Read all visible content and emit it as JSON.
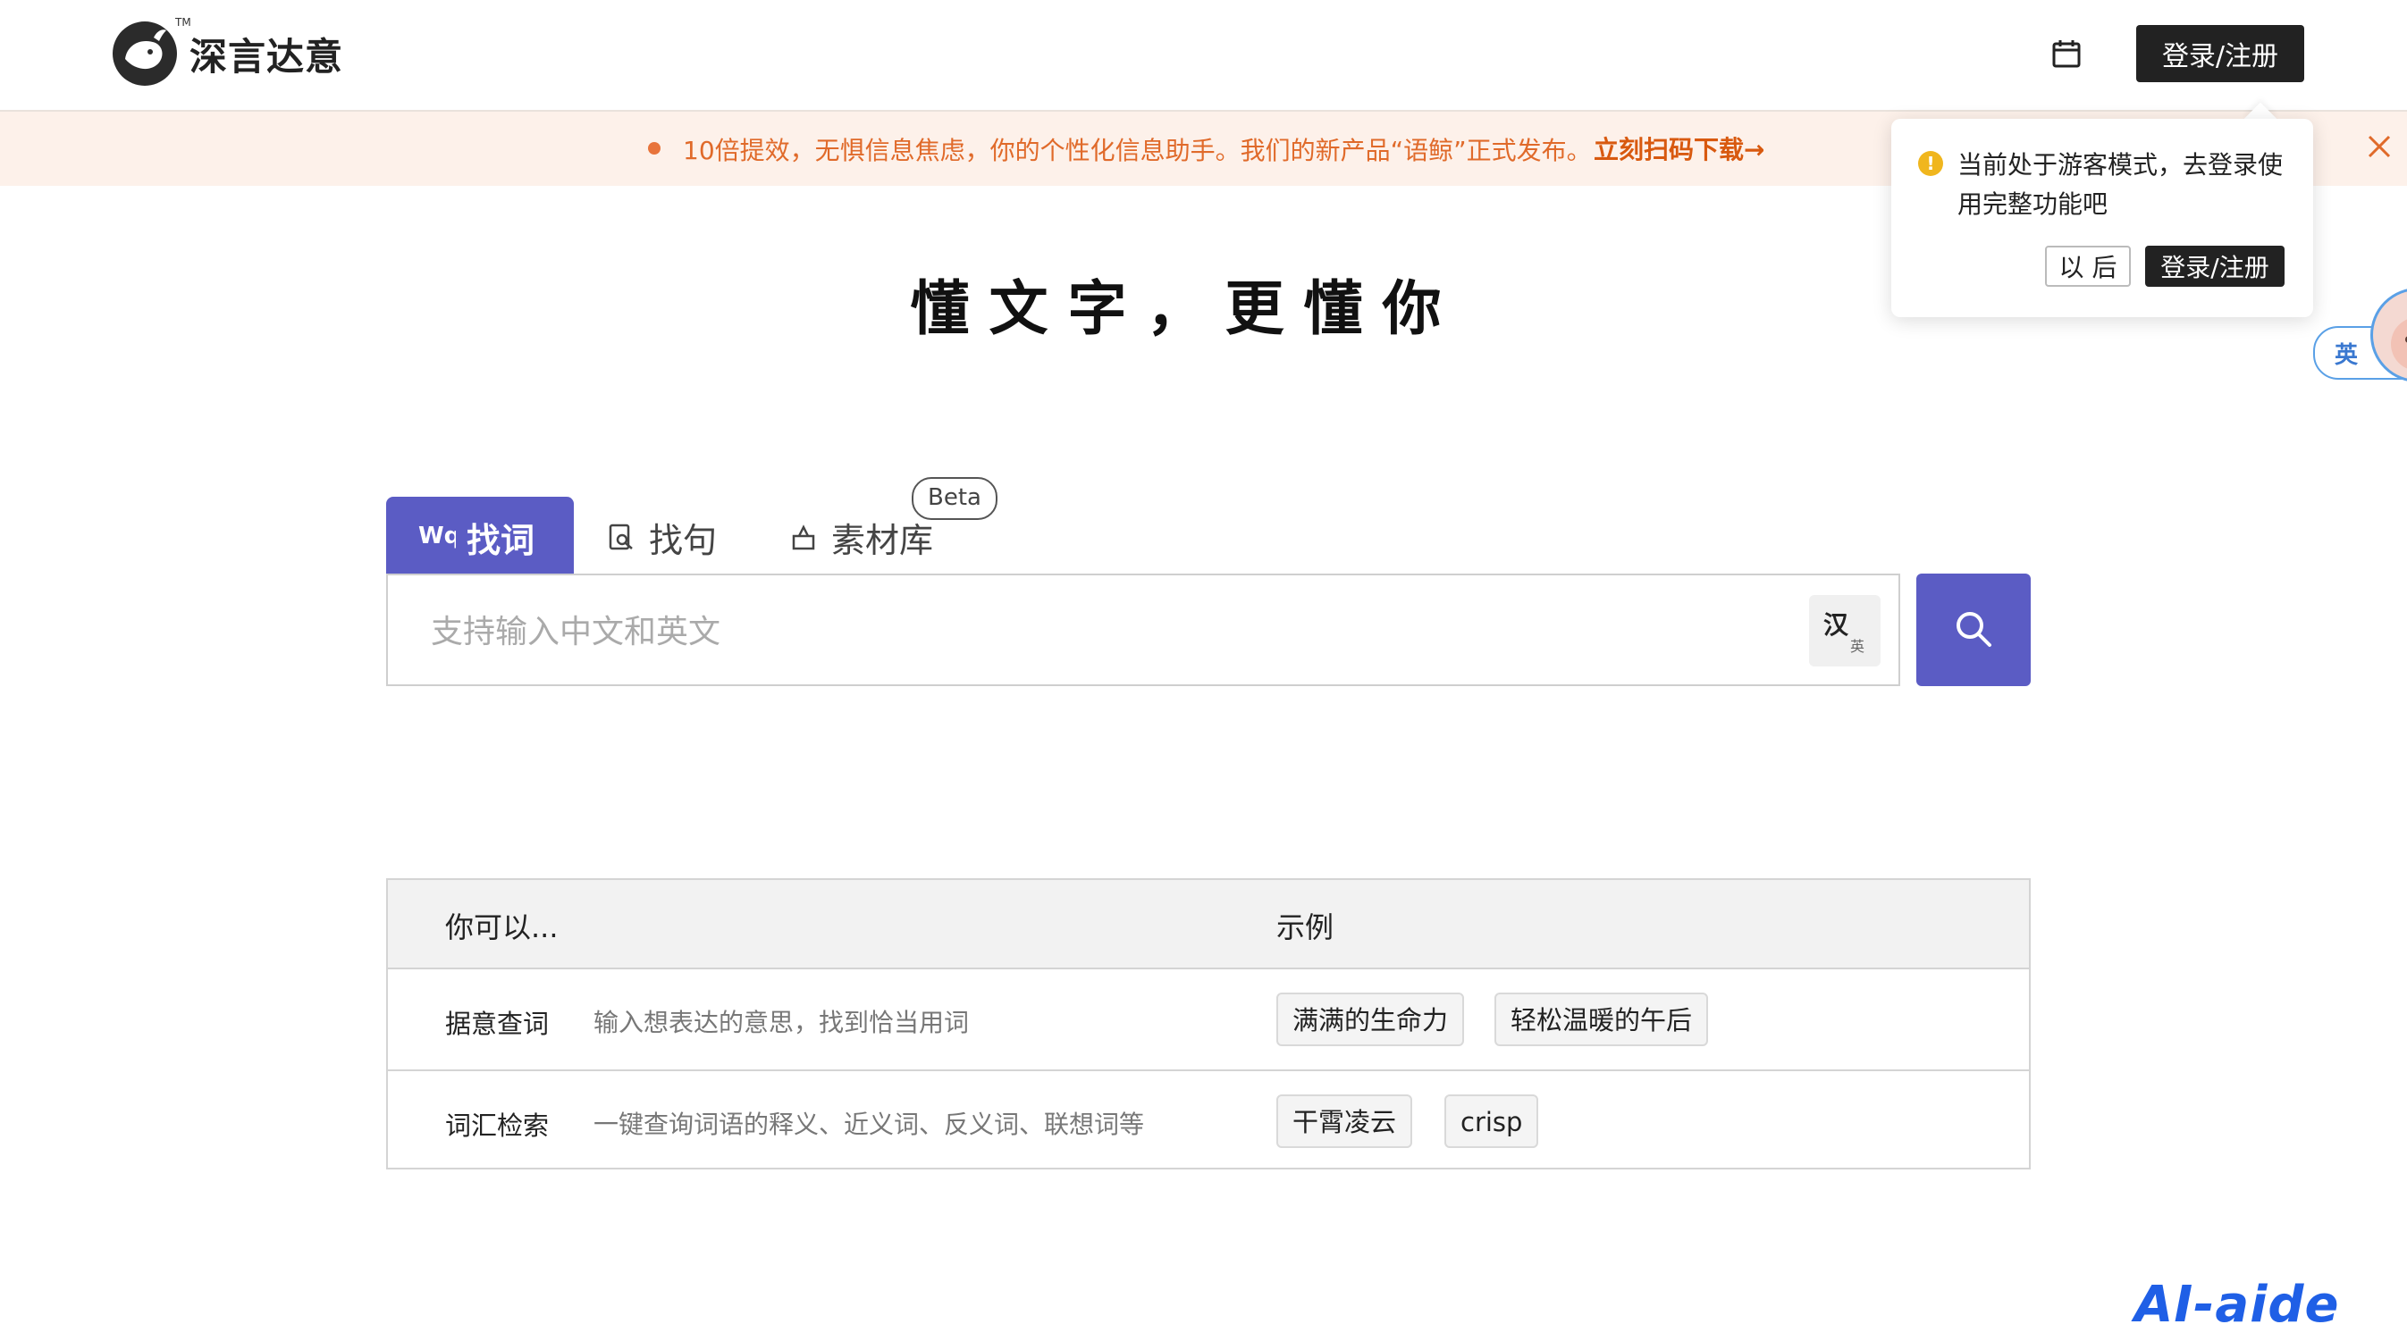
{
  "header": {
    "brand": "深言达意",
    "tm": "TM",
    "login_label": "登录/注册"
  },
  "banner": {
    "text": "10倍提效，无惧信息焦虑，你的个性化信息助手。我们的新产品“语鲸”正式发布。",
    "link": "立刻扫码下载→"
  },
  "popover": {
    "icon": "!",
    "message": "当前处于游客模式，去登录使用完整功能吧",
    "later_label": "以 后",
    "login_label": "登录/注册"
  },
  "float_widget": {
    "label": "英"
  },
  "slogan": "懂文字，更懂你",
  "tabs": [
    {
      "label": "找词",
      "active": true
    },
    {
      "label": "找句",
      "active": false
    },
    {
      "label": "素材库",
      "active": false,
      "badge": "Beta"
    }
  ],
  "search": {
    "placeholder": "支持输入中文和英文",
    "lang_from": "汉",
    "lang_to": "英"
  },
  "tips": {
    "col_you_can": "你可以...",
    "col_example": "示例",
    "rows": [
      {
        "name": "据意查词",
        "desc": "输入想表达的意思，找到恰当用词",
        "examples": [
          "满满的生命力",
          "轻松温暖的午后"
        ]
      },
      {
        "name": "词汇检索",
        "desc": "一键查询词语的释义、近义词、反义词、联想词等",
        "examples": [
          "干霄凌云",
          "crisp"
        ]
      }
    ]
  },
  "watermark": "AI-aide",
  "colors": {
    "accent": "#5b5cc4",
    "banner_bg": "#fdf1ea",
    "banner_text": "#e06a2a",
    "dark_button": "#222222",
    "warning": "#f0b61e"
  }
}
